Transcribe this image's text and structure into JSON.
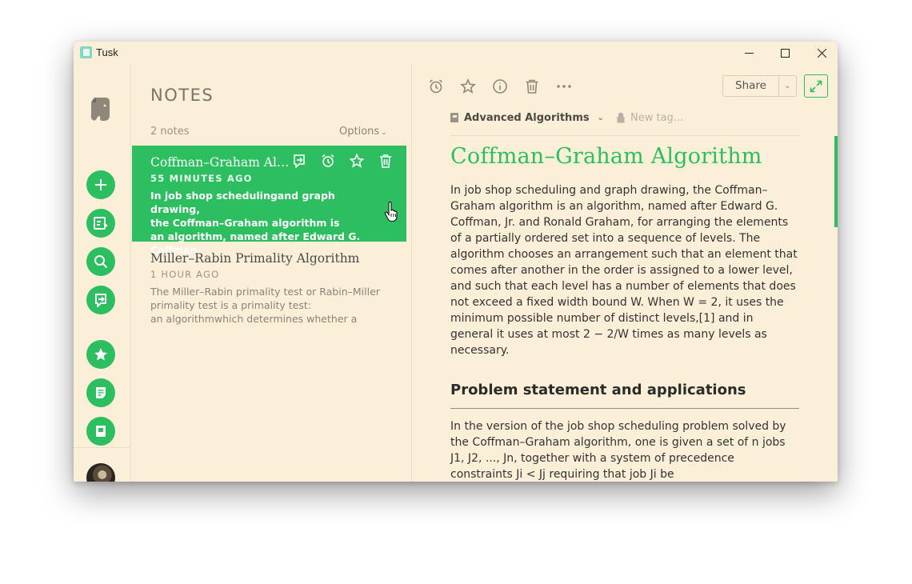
{
  "window": {
    "title": "Tusk",
    "controls": {
      "minimize": "minimize-icon",
      "maximize": "maximize-icon",
      "close": "close-icon"
    }
  },
  "sidebar": {
    "logo": "elephant-logo",
    "buttons": [
      {
        "name": "new-note",
        "icon": "plus-icon"
      },
      {
        "name": "new-notebook",
        "icon": "edit-icon"
      },
      {
        "name": "search",
        "icon": "search-icon"
      },
      {
        "name": "work-chat",
        "icon": "chat-icon"
      },
      {
        "name": "shortcuts",
        "icon": "star-icon"
      },
      {
        "name": "notes",
        "icon": "note-icon"
      },
      {
        "name": "notebooks",
        "icon": "notebook-icon"
      }
    ],
    "avatar": "user-avatar"
  },
  "notes_list": {
    "heading": "NOTES",
    "count": "2 notes",
    "options_label": "Options",
    "items": [
      {
        "title": "Coffman–Graham Algorithm",
        "time": "55 MINUTES AGO",
        "snippet": "In job shop schedulingand graph drawing,\nthe Coffman–Graham algorithm is\nan algorithm, named after Edward G. Coffman,"
      },
      {
        "title": "Miller–Rabin Primality Algorithm",
        "time": "1 HOUR AGO",
        "snippet": "The Miller–Rabin primality test or Rabin–Miller\nprimality test is a primality test:\nan algorithmwhich determines whether a"
      }
    ]
  },
  "editor": {
    "toolbar": {
      "icons": [
        "reminder-icon",
        "star-icon",
        "info-icon",
        "trash-icon",
        "more-icon"
      ],
      "share_label": "Share"
    },
    "notebook_label": "Advanced Algorithms",
    "tag_placeholder": "New tag...",
    "title": "Coffman–Graham Algorithm",
    "body_paragraph": "In job shop scheduling and graph drawing, the Coffman–Graham algorithm is an algorithm, named after Edward G. Coffman, Jr. and Ronald Graham, for arranging the elements of a partially ordered set into a sequence of levels. The algorithm chooses an arrangement such that an element that comes after another in the order is assigned to a lower level, and such that each level has a number of elements that does not exceed a fixed width bound W. When W = 2, it uses the minimum possible number of distinct levels,[1] and in general it uses at most 2 − 2/W times as many levels as necessary.",
    "section_heading": "Problem statement and applications",
    "section_paragraph": "In the version of the job shop scheduling problem solved by the Coffman–Graham algorithm, one is given a set of n jobs J1, J2, ..., Jn, together with a system of precedence constraints Ji < Jj requiring that job Ji be"
  },
  "colors": {
    "accent": "#2dbe60",
    "background": "#fbefd7"
  }
}
